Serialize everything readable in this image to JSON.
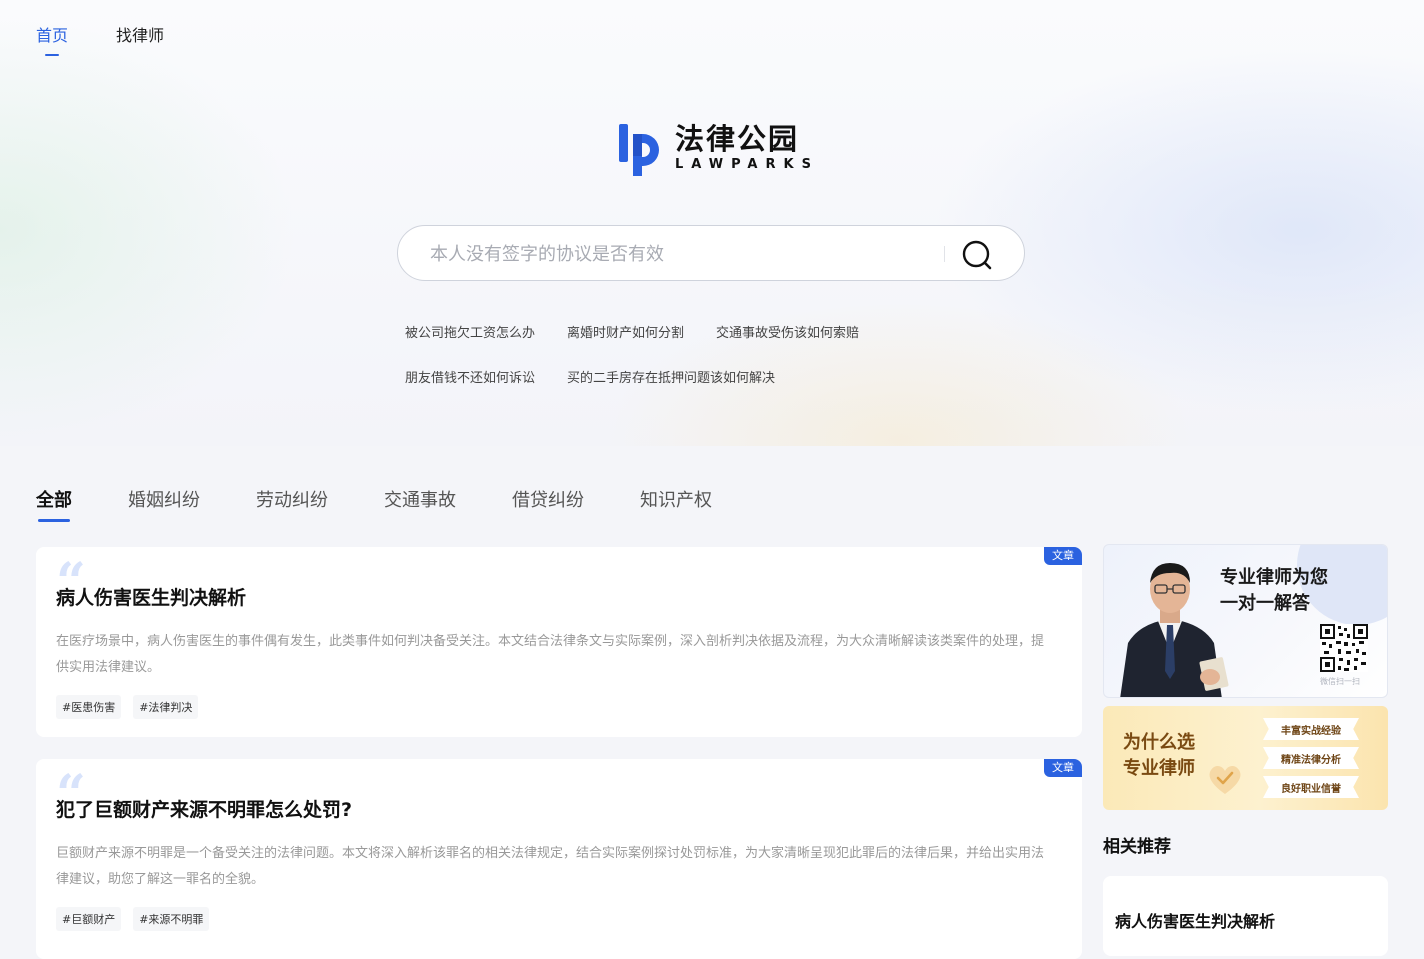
{
  "nav": {
    "items": [
      "首页",
      "找律师"
    ],
    "active_index": 0
  },
  "logo": {
    "cn": "法律公园",
    "en": "LAWPARKS",
    "brand_color": "#2b62e0"
  },
  "search": {
    "placeholder": "本人没有签字的协议是否有效",
    "icon": "search-icon"
  },
  "suggestions": {
    "row1": [
      "被公司拖欠工资怎么办",
      "离婚时财产如何分割",
      "交通事故受伤该如何索赔"
    ],
    "row2": [
      "朋友借钱不还如何诉讼",
      "买的二手房存在抵押问题该如何解决"
    ]
  },
  "tabs": {
    "items": [
      "全部",
      "婚姻纠纷",
      "劳动纠纷",
      "交通事故",
      "借贷纠纷",
      "知识产权"
    ],
    "active_index": 0
  },
  "articles": [
    {
      "badge": "文章",
      "title": "病人伤害医生判决解析",
      "desc": "在医疗场景中，病人伤害医生的事件偶有发生，此类事件如何判决备受关注。本文结合法律条文与实际案例，深入剖析判决依据及流程，为大众清晰解读该类案件的处理，提供实用法律建议。",
      "tags": [
        "#医患伤害",
        "#法律判决"
      ]
    },
    {
      "badge": "文章",
      "title": "犯了巨额财产来源不明罪怎么处罚?",
      "desc": "巨额财产来源不明罪是一个备受关注的法律问题。本文将深入解析该罪名的相关法律规定，结合实际案例探讨处罚标准，为大家清晰呈现犯此罪后的法律后果，并给出实用法律建议，助您了解这一罪名的全貌。",
      "tags": [
        "#巨额财产",
        "#来源不明罪"
      ]
    }
  ],
  "sidebar": {
    "promo1": {
      "line1": "专业律师为您",
      "line2": "一对一解答",
      "qr_caption": "微信扫一扫"
    },
    "promo2": {
      "line1": "为什么选",
      "line2": "专业律师",
      "features": [
        "丰富实战经验",
        "精准法律分析",
        "良好职业信誉"
      ]
    },
    "related_title": "相关推荐",
    "related_items": [
      "病人伤害医生判决解析"
    ]
  }
}
